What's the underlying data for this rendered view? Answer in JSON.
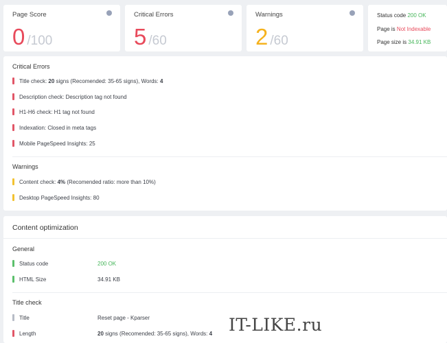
{
  "scores": [
    {
      "title": "Page Score",
      "value": "0",
      "max": "100",
      "color": "#e84a5b"
    },
    {
      "title": "Critical Errors",
      "value": "5",
      "max": "60",
      "color": "#e84a5b"
    },
    {
      "title": "Warnings",
      "value": "2",
      "max": "60",
      "color": "#f5b21e"
    }
  ],
  "slash": "/",
  "status": {
    "status_code_label": "Status code",
    "status_code_value": "200 OK",
    "page_is_label": "Page is",
    "page_is_value": "Not Indexable",
    "page_size_label": "Page size is",
    "page_size_value": "34.91 KB"
  },
  "critical": {
    "title": "Critical Errors",
    "items": [
      {
        "pre": "Title check: ",
        "bold": "20",
        "post": " signs (Recomended: 35-65 signs), Words: ",
        "bold2": "4"
      },
      {
        "text": "Description check: Description tag not found"
      },
      {
        "text": "H1-H6 check: H1 tag not found"
      },
      {
        "text": "Indexation: Closed in meta tags"
      },
      {
        "text": "Mobile PageSpeed Insights: 25"
      }
    ]
  },
  "warnings": {
    "title": "Warnings",
    "items": [
      {
        "pre": "Content check: ",
        "bold": "4%",
        "post": " (Recomended ratio: more than 10%)"
      },
      {
        "text": "Desktop PageSpeed Insights: 80"
      }
    ]
  },
  "content": {
    "title": "Content optimization",
    "general_title": "General",
    "general": [
      {
        "key": "Status code",
        "value": "200 OK"
      },
      {
        "key": "HTML Size",
        "value": "34.91 KB"
      }
    ],
    "title_check_title": "Title check",
    "title_check": [
      {
        "key": "Title",
        "value": "Reset page - Kparser"
      },
      {
        "key": "Length",
        "pre": "",
        "bold": "20",
        "post": " signs (Recomended: 35-65 signs), Words: ",
        "bold2": "4"
      }
    ]
  },
  "watermark": "IT-LIKE.ru"
}
